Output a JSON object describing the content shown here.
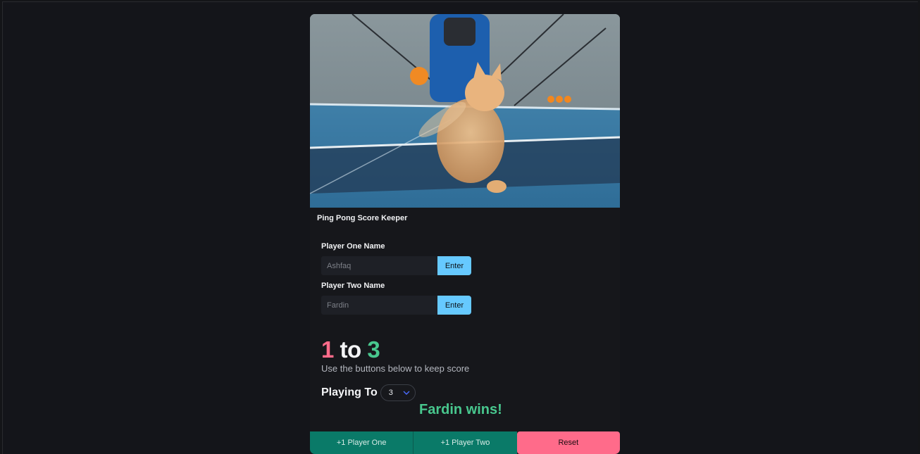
{
  "app": {
    "title": "Ping Pong Score Keeper"
  },
  "hero": {
    "icon": "cat-playing-ping-pong-photo"
  },
  "players": {
    "one_label": "Player One Name",
    "one_placeholder": "Ashfaq",
    "one_enter": "Enter",
    "two_label": "Player Two Name",
    "two_placeholder": "Fardin",
    "two_enter": "Enter"
  },
  "score": {
    "player_one": "1",
    "separator": "to",
    "player_two": "3",
    "subtitle": "Use the buttons below to keep score"
  },
  "playing_to": {
    "label": "Playing To",
    "value": "3"
  },
  "result": {
    "message": "Fardin wins!"
  },
  "buttons": {
    "player_one": "+1 Player One",
    "player_two": "+1 Player Two",
    "reset": "Reset"
  },
  "colors": {
    "accent": "#66c9ff",
    "player_one": "#ff6b8a",
    "player_two": "#48c78e",
    "button_green": "#0a7a68",
    "reset": "#ff6b8a"
  }
}
